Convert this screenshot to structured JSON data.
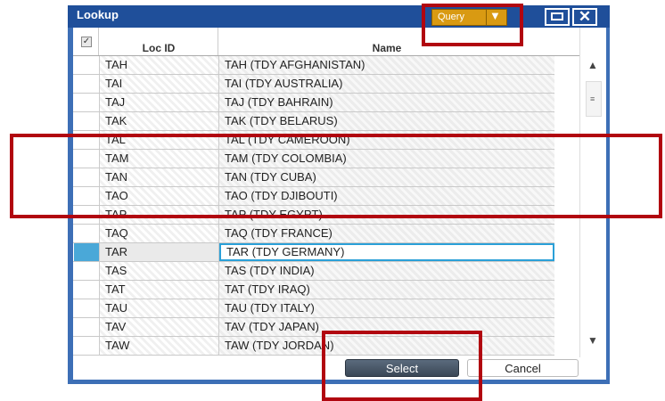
{
  "window": {
    "title": "Lookup"
  },
  "toolbar": {
    "query_label": "Query",
    "query_caret": "▼",
    "close_glyph": "✕"
  },
  "columns": {
    "loc_id": "Loc ID",
    "name": "Name"
  },
  "rows": [
    {
      "loc": "TAH",
      "name": "TAH (TDY AFGHANISTAN)"
    },
    {
      "loc": "TAI",
      "name": "TAI (TDY AUSTRALIA)"
    },
    {
      "loc": "TAJ",
      "name": "TAJ (TDY BAHRAIN)"
    },
    {
      "loc": "TAK",
      "name": "TAK (TDY BELARUS)"
    },
    {
      "loc": "TAL",
      "name": "TAL (TDY CAMEROON)"
    },
    {
      "loc": "TAM",
      "name": "TAM (TDY COLOMBIA)"
    },
    {
      "loc": "TAN",
      "name": "TAN (TDY CUBA)"
    },
    {
      "loc": "TAO",
      "name": "TAO (TDY DJIBOUTI)"
    },
    {
      "loc": "TAP",
      "name": "TAP (TDY EGYPT)"
    },
    {
      "loc": "TAQ",
      "name": "TAQ (TDY FRANCE)"
    },
    {
      "loc": "TAR",
      "name": "TAR (TDY GERMANY)",
      "selected": true
    },
    {
      "loc": "TAS",
      "name": "TAS (TDY INDIA)"
    },
    {
      "loc": "TAT",
      "name": "TAT (TDY IRAQ)"
    },
    {
      "loc": "TAU",
      "name": "TAU (TDY ITALY)"
    },
    {
      "loc": "TAV",
      "name": "TAV (TDY JAPAN)"
    },
    {
      "loc": "TAW",
      "name": "TAW (TDY JORDAN)"
    }
  ],
  "buttons": {
    "select": "Select",
    "cancel": "Cancel"
  },
  "scrollbar": {
    "up": "▲",
    "down": "▼",
    "grip": "≡"
  },
  "colors": {
    "title_bar": "#1f4f9a",
    "query_button": "#d99a12",
    "highlight": "#b10610",
    "selected_row": "#2aa0d8"
  }
}
